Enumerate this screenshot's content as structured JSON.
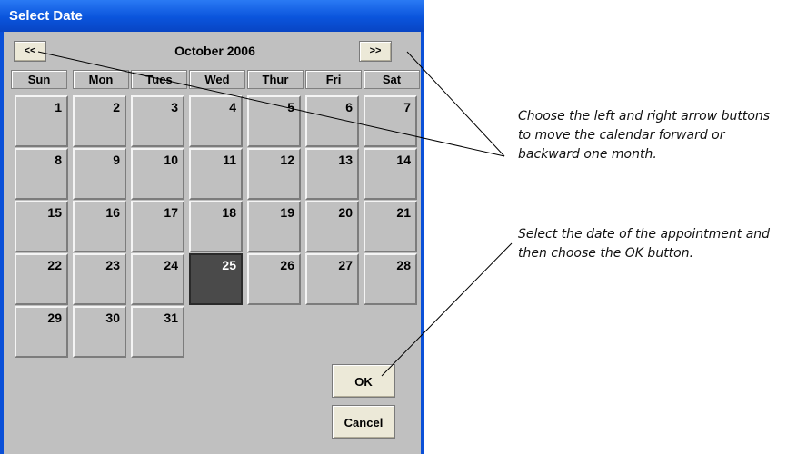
{
  "window": {
    "title": "Select Date"
  },
  "nav": {
    "prev_label": "<<",
    "next_label": ">>",
    "month_label": "October 2006"
  },
  "weekdays": [
    "Sun",
    "Mon",
    "Tues",
    "Wed",
    "Thur",
    "Fri",
    "Sat"
  ],
  "days": [
    {
      "label": "1"
    },
    {
      "label": "2"
    },
    {
      "label": "3"
    },
    {
      "label": "4"
    },
    {
      "label": "5"
    },
    {
      "label": "6"
    },
    {
      "label": "7"
    },
    {
      "label": "8"
    },
    {
      "label": "9"
    },
    {
      "label": "10"
    },
    {
      "label": "11"
    },
    {
      "label": "12"
    },
    {
      "label": "13"
    },
    {
      "label": "14"
    },
    {
      "label": "15"
    },
    {
      "label": "16"
    },
    {
      "label": "17"
    },
    {
      "label": "18"
    },
    {
      "label": "19"
    },
    {
      "label": "20"
    },
    {
      "label": "21"
    },
    {
      "label": "22"
    },
    {
      "label": "23"
    },
    {
      "label": "24"
    },
    {
      "label": "25",
      "selected": true
    },
    {
      "label": "26"
    },
    {
      "label": "27"
    },
    {
      "label": "28"
    },
    {
      "label": "29"
    },
    {
      "label": "30"
    },
    {
      "label": "31"
    }
  ],
  "buttons": {
    "ok_label": "OK",
    "cancel_label": "Cancel"
  },
  "annotations": {
    "arrows_note": [
      "Choose the left and right arrow buttons",
      "to move the calendar forward or",
      "backward one month."
    ],
    "ok_note": [
      "Select the date of the appointment and",
      "then choose the OK button."
    ]
  },
  "colors": {
    "titlebar": "#0a54dc",
    "client": "#c0c0c0",
    "selected_day": "#4a4a4a",
    "button_face": "#ece9d8"
  }
}
